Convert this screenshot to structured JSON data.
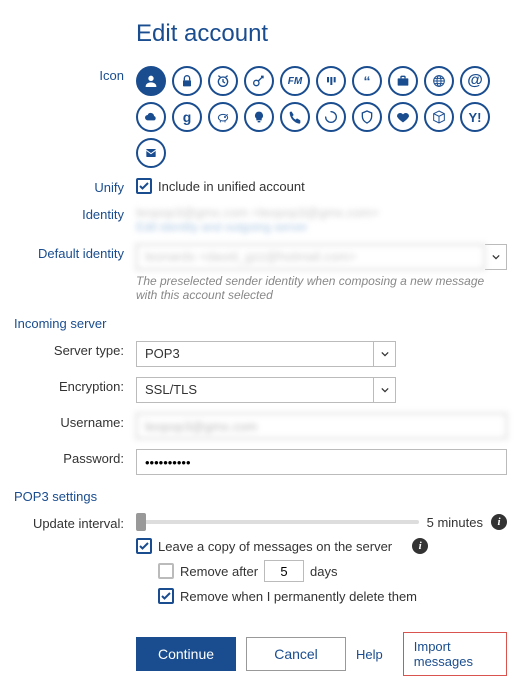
{
  "title": "Edit account",
  "labels": {
    "icon": "Icon",
    "unify": "Unify",
    "identity": "Identity",
    "default_identity": "Default identity",
    "server_type": "Server type:",
    "encryption": "Encryption:",
    "username": "Username:",
    "password": "Password:",
    "update_interval": "Update interval:"
  },
  "unify": {
    "include_label": "Include in unified account",
    "checked": true
  },
  "identity": {
    "value": "leopop3@gmx.com <leopop3@gmx.com>",
    "edit_link": "Edit identity and outgoing server"
  },
  "default_identity": {
    "value": "leonardo <david_gzz@hotmail.com>",
    "hint": "The preselected sender identity when composing a new message with this account selected"
  },
  "sections": {
    "incoming": "Incoming server",
    "pop3": "POP3 settings"
  },
  "server": {
    "type": "POP3",
    "encryption": "SSL/TLS",
    "username": "leopop3@gmx.com",
    "password": "••••••••••"
  },
  "pop3": {
    "interval_text": "5 minutes",
    "leave_copy": {
      "label": "Leave a copy of messages on the server",
      "checked": true
    },
    "remove_after": {
      "label_before": "Remove after",
      "days": "5",
      "label_after": "days",
      "checked": false
    },
    "remove_delete": {
      "label": "Remove when I permanently delete them",
      "checked": true
    }
  },
  "buttons": {
    "continue": "Continue",
    "cancel": "Cancel",
    "help": "Help",
    "import": "Import messages"
  },
  "icons": [
    "person",
    "lock",
    "alarm",
    "key",
    "fm",
    "mastodon",
    "quotes",
    "briefcase",
    "globe",
    "at",
    "cloud",
    "google",
    "piggy",
    "bulb",
    "phone",
    "spinner",
    "shield",
    "heart",
    "cube",
    "yahoo",
    "outlook"
  ]
}
